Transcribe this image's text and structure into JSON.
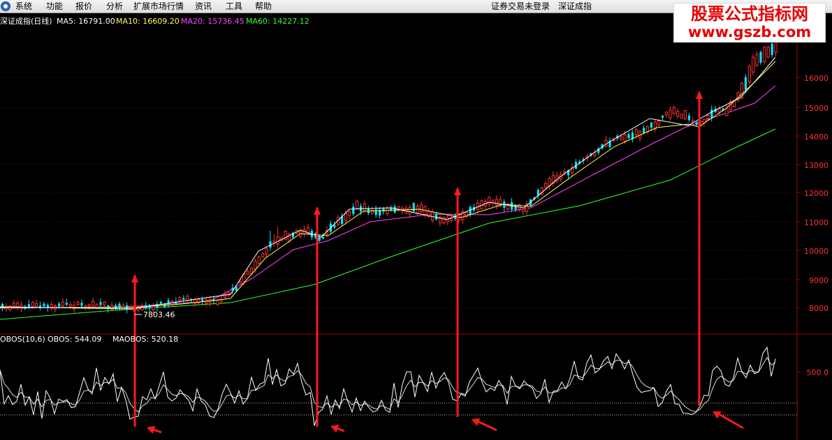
{
  "menu": {
    "items": [
      "系统",
      "功能",
      "报价",
      "分析",
      "扩展市场行情",
      "资讯",
      "工具",
      "帮助"
    ],
    "status_login": "证券交易未登录",
    "status_index": "深证成指"
  },
  "price_panel": {
    "title": "深证成指(日线)",
    "indicators": [
      {
        "label": "MA5: 16791.00",
        "color": "#ffffff"
      },
      {
        "label": "MA10: 16609.20",
        "color": "#ffff55"
      },
      {
        "label": "MA20: 15736.45",
        "color": "#ff44ff"
      },
      {
        "label": "MA60: 14227.12",
        "color": "#33ff33"
      }
    ],
    "y_ticks": [
      "16000",
      "15000",
      "14000",
      "13000",
      "12000",
      "11000",
      "10000",
      "9000",
      "8000"
    ],
    "low_marker": "7803.46"
  },
  "osc_panel": {
    "title": "OBOS(10,6)",
    "obos_value": "OBOS: 544.09",
    "maobos_value": "MAOBOS: 520.18",
    "y_tick": "500.0"
  },
  "watermark": {
    "line1": "股票公式指标网",
    "line2": "www.gszb.com"
  },
  "colors": {
    "background": "#000000",
    "grid": "#7a0000",
    "candle_up": "#ff3030",
    "candle_down": "#00e5ff",
    "ma5": "#ffffff",
    "ma10": "#ffff55",
    "ma20": "#ff44ff",
    "ma60": "#33ff33",
    "axis_text": "#ff3333",
    "arrow": "#ff1a1a"
  },
  "icons": [
    "app-logo-icon",
    "arrow-up-icon",
    "arrow-diagonal-icon"
  ]
}
